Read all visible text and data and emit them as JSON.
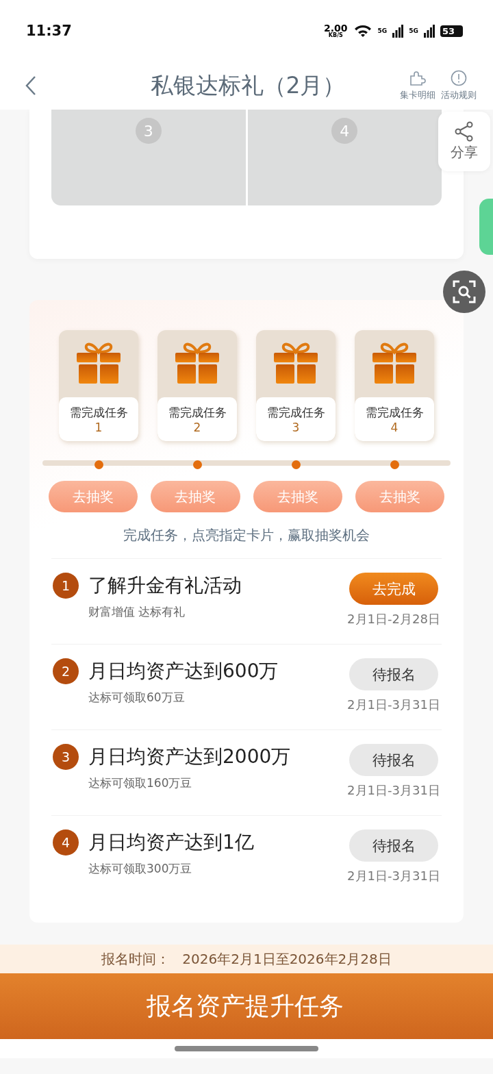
{
  "status_bar": {
    "time": "11:37",
    "speed": "2.00",
    "speed_unit": "KB/S",
    "network_1": "5G",
    "network_2": "5G",
    "battery": "53"
  },
  "header": {
    "title": "私银达标礼（2月）",
    "actions": [
      {
        "kind": "puzzle",
        "label": "集卡明细"
      },
      {
        "kind": "info",
        "label": "活动规则"
      }
    ]
  },
  "card_slots": [
    {
      "number": "3"
    },
    {
      "number": "4"
    }
  ],
  "share": {
    "label": "分享"
  },
  "gifts": [
    {
      "label": "需完成任务",
      "number": "1",
      "action": "去抽奖"
    },
    {
      "label": "需完成任务",
      "number": "2",
      "action": "去抽奖"
    },
    {
      "label": "需完成任务",
      "number": "3",
      "action": "去抽奖"
    },
    {
      "label": "需完成任务",
      "number": "4",
      "action": "去抽奖"
    }
  ],
  "hint": "完成任务，点亮指定卡片，赢取抽奖机会",
  "tasks": [
    {
      "number": "1",
      "title": "了解升金有礼活动",
      "subtitle": "财富增值 达标有礼",
      "button": "去完成",
      "kind": "go",
      "dates": "2月1日-2月28日"
    },
    {
      "number": "2",
      "title": "月日均资产达到600万",
      "subtitle": "达标可领取60万豆",
      "button": "待报名",
      "kind": "pending",
      "dates": "2月1日-3月31日"
    },
    {
      "number": "3",
      "title": "月日均资产达到2000万",
      "subtitle": "达标可领取160万豆",
      "button": "待报名",
      "kind": "pending",
      "dates": "2月1日-3月31日"
    },
    {
      "number": "4",
      "title": "月日均资产达到1亿",
      "subtitle": "达标可领取300万豆",
      "button": "待报名",
      "kind": "pending",
      "dates": "2月1日-3月31日"
    }
  ],
  "registration": {
    "label": "报名时间：",
    "period": "2026年2月1日至2026年2月28日"
  },
  "cta": "报名资产提升任务"
}
